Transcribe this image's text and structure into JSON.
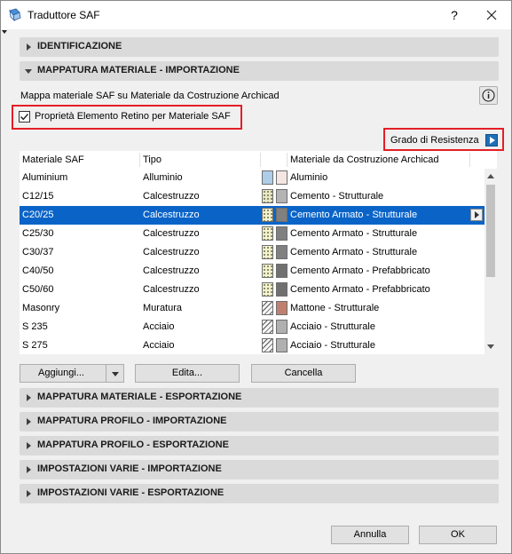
{
  "window": {
    "title": "Traduttore SAF",
    "help": "?"
  },
  "sections": {
    "identificazione": "IDENTIFICAZIONE",
    "mappatura_import": "MAPPATURA MATERIALE - IMPORTAZIONE",
    "mappatura_export": "MAPPATURA MATERIALE - ESPORTAZIONE",
    "profilo_import": "MAPPATURA PROFILO - IMPORTAZIONE",
    "profilo_export": "MAPPATURA PROFILO - ESPORTAZIONE",
    "varie_import": "IMPOSTAZIONI VARIE - IMPORTAZIONE",
    "varie_export": "IMPOSTAZIONI VARIE - ESPORTAZIONE"
  },
  "mapping": {
    "description": "Mappa materiale SAF su Materiale da Costruzione Archicad",
    "checkbox_label": "Proprietà Elemento Retino per Materiale SAF",
    "checkbox_checked": true,
    "grade_label": "Grado di Resistenza"
  },
  "table": {
    "columns": [
      "Materiale SAF",
      "Tipo",
      "Materiale da Costruzione Archicad"
    ],
    "rows": [
      {
        "saf": "Aluminium",
        "tipo": "Alluminio",
        "archicad": "Aluminio",
        "pattern": "#aecde8",
        "color": "#f4e6e2"
      },
      {
        "saf": "C12/15",
        "tipo": "Calcestruzzo",
        "archicad": "Cemento - Strutturale",
        "pattern": "#e8e8c8",
        "color": "#b4b4b4"
      },
      {
        "saf": "C20/25",
        "tipo": "Calcestruzzo",
        "archicad": "Cemento Armato - Strutturale",
        "pattern": "#f2f2d0",
        "color": "#808080",
        "selected": true
      },
      {
        "saf": "C25/30",
        "tipo": "Calcestruzzo",
        "archicad": "Cemento Armato - Strutturale",
        "pattern": "#f2f2d0",
        "color": "#808080"
      },
      {
        "saf": "C30/37",
        "tipo": "Calcestruzzo",
        "archicad": "Cemento Armato - Strutturale",
        "pattern": "#f2f2d0",
        "color": "#808080"
      },
      {
        "saf": "C40/50",
        "tipo": "Calcestruzzo",
        "archicad": "Cemento Armato - Prefabbricato",
        "pattern": "#f2f2d0",
        "color": "#707070"
      },
      {
        "saf": "C50/60",
        "tipo": "Calcestruzzo",
        "archicad": "Cemento Armato - Prefabbricato",
        "pattern": "#f2f2d0",
        "color": "#707070"
      },
      {
        "saf": "Masonry",
        "tipo": "Muratura",
        "archicad": "Mattone - Strutturale",
        "pattern": "#f4f4f4",
        "color": "#c08070"
      },
      {
        "saf": "S 235",
        "tipo": "Acciaio",
        "archicad": "Acciaio - Strutturale",
        "pattern": "#f4f4f4",
        "color": "#b0b0b0"
      },
      {
        "saf": "S 275",
        "tipo": "Acciaio",
        "archicad": "Acciaio - Strutturale",
        "pattern": "#f4f4f4",
        "color": "#b0b0b0"
      }
    ]
  },
  "buttons": {
    "add": "Aggiungi...",
    "edit": "Edita...",
    "delete": "Cancella",
    "cancel": "Annulla",
    "ok": "OK"
  },
  "colors": {
    "selection": "#0a64c8",
    "highlight_box": "#e41e26",
    "accent": "#1f6fb8"
  }
}
